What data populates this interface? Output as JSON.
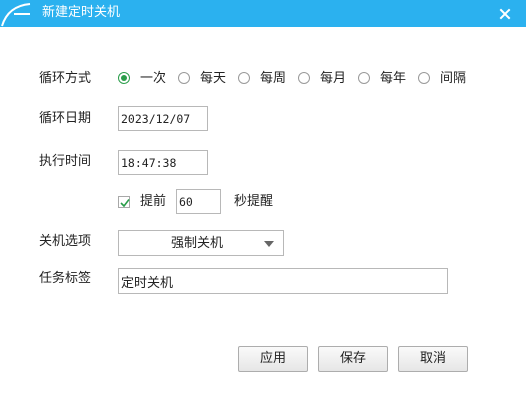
{
  "window": {
    "title": "新建定时关机",
    "accent_color": "#2bb1ef"
  },
  "form": {
    "repeat_mode": {
      "label": "循环方式",
      "selected": "一次",
      "options": [
        "一次",
        "每天",
        "每周",
        "每月",
        "每年",
        "间隔"
      ]
    },
    "repeat_date": {
      "label": "循环日期",
      "value": "2023/12/07"
    },
    "exec_time": {
      "label": "执行时间",
      "value": "18:47:38"
    },
    "advance": {
      "checked": true,
      "label": "提前",
      "seconds": "60",
      "suffix": "秒提醒"
    },
    "shutdown_option": {
      "label": "关机选项",
      "selected": "强制关机"
    },
    "task_label": {
      "label": "任务标签",
      "value": "定时关机"
    }
  },
  "buttons": {
    "apply": "应用",
    "save": "保存",
    "cancel": "取消"
  }
}
